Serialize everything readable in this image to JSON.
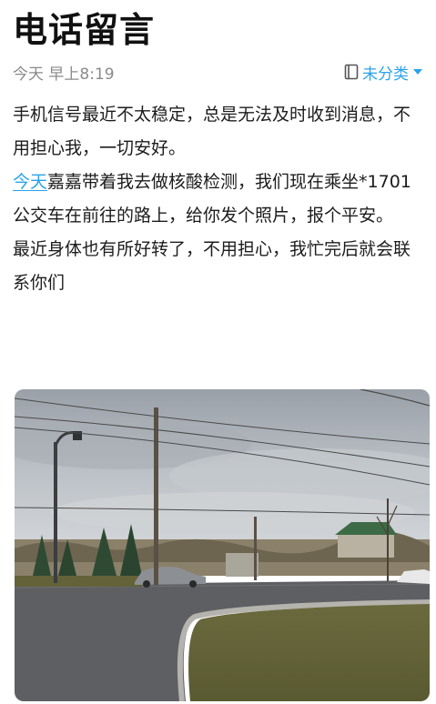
{
  "note": {
    "title": "电话留言",
    "time": "今天 早上8:19",
    "category_label": "未分类",
    "paragraphs": {
      "p1": "手机信号最近不太稳定，总是无法及时收到消息，不用担心我，一切安好。",
      "p2_link": "今天",
      "p2_rest": "嘉嘉带着我去做核酸检测，我们现在乘坐*1701公交车在前往的路上，给你发个照片，报个平安。",
      "p3": "最近身体也有所好转了，不用担心，我忙完后就会联系你们"
    }
  },
  "icons": {
    "category": "notebook-icon",
    "dropdown": "caret-down-icon"
  },
  "colors": {
    "accent": "#29a3ec",
    "meta_text": "#8a8a8a",
    "body_text": "#1c1c1c"
  }
}
